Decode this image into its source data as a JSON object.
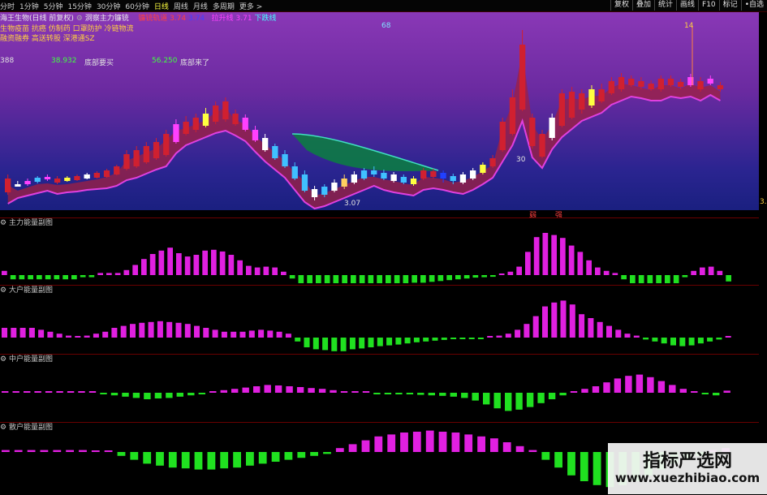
{
  "toolbar": {
    "periods": [
      "分时",
      "1分钟",
      "5分钟",
      "15分钟",
      "30分钟",
      "60分钟",
      "日线",
      "周线",
      "月线",
      "多周期",
      "更多 >"
    ],
    "active_index": 6,
    "right_buttons": [
      "复权",
      "叠加",
      "统计",
      "画线",
      "F10",
      "标记",
      "•自选"
    ]
  },
  "main": {
    "stock_title": "海王生物(日线 前复权)",
    "indicator_name": "洞察主力镰铳",
    "line1_label": "镰铳轨道",
    "line1_value": "3.74",
    "line2_value": "3.74",
    "line3_label": "拉升线",
    "line3_value": "3.71",
    "line4_label": "下跌线",
    "tag_68": "68",
    "tag_14": "14",
    "concept1": "生物疫苗 抗癌 仿制药 口罩防护 冷链物流",
    "concept2": "融资融券 高送转股 深港通SZ",
    "val_388": "388",
    "val_38932": "38.932",
    "bottom_label1": "底部要买",
    "val_56250": "56.250",
    "bottom_label2": "底部来了",
    "label_30": "30",
    "low_price": "3.07",
    "axis_right": "3.0",
    "marker1": "弱",
    "marker2": "强"
  },
  "panels": [
    {
      "name": "主力能量副图"
    },
    {
      "name": "大户能量副图"
    },
    {
      "name": "中户能量副图"
    },
    {
      "name": "散户能量副图"
    }
  ],
  "bars": {
    "main": [
      0.1,
      -0.1,
      -0.1,
      -0.1,
      -0.1,
      -0.1,
      -0.1,
      -0.1,
      -0.1,
      -0.05,
      -0.05,
      0.05,
      0.05,
      0.05,
      0.12,
      0.24,
      0.38,
      0.5,
      0.58,
      0.65,
      0.52,
      0.44,
      0.48,
      0.58,
      0.6,
      0.56,
      0.48,
      0.35,
      0.22,
      0.18,
      0.2,
      0.18,
      0.08,
      -0.08,
      -0.25,
      -0.3,
      -0.32,
      -0.36,
      -0.36,
      -0.34,
      -0.32,
      -0.3,
      -0.28,
      -0.26,
      -0.24,
      -0.22,
      -0.2,
      -0.18,
      -0.18,
      -0.16,
      -0.14,
      -0.12,
      -0.1,
      -0.08,
      -0.06,
      -0.05,
      -0.04,
      0.02,
      0.08,
      0.2,
      0.55,
      0.9,
      1.0,
      0.95,
      0.88,
      0.7,
      0.55,
      0.35,
      0.18,
      0.1,
      0.05,
      -0.1,
      -0.2,
      -0.28,
      -0.35,
      -0.38,
      -0.32,
      -0.22,
      -0.05,
      0.1,
      0.18,
      0.2,
      0.1,
      -0.15
    ],
    "big": [
      0.25,
      0.25,
      0.25,
      0.25,
      0.2,
      0.15,
      0.1,
      0.05,
      0.02,
      0.05,
      0.1,
      0.15,
      0.25,
      0.3,
      0.35,
      0.38,
      0.4,
      0.42,
      0.4,
      0.38,
      0.35,
      0.3,
      0.25,
      0.2,
      0.15,
      0.15,
      0.15,
      0.18,
      0.2,
      0.18,
      0.15,
      0.1,
      -0.1,
      -0.25,
      -0.3,
      -0.32,
      -0.35,
      -0.35,
      -0.3,
      -0.28,
      -0.25,
      -0.22,
      -0.2,
      -0.18,
      -0.15,
      -0.12,
      -0.1,
      -0.08,
      -0.06,
      -0.04,
      -0.03,
      -0.02,
      -0.01,
      0.02,
      0.05,
      0.1,
      0.2,
      0.35,
      0.55,
      0.8,
      0.9,
      0.95,
      0.85,
      0.6,
      0.5,
      0.4,
      0.3,
      0.2,
      0.1,
      0.05,
      -0.05,
      -0.1,
      -0.15,
      -0.2,
      -0.22,
      -0.2,
      -0.15,
      -0.1,
      -0.05,
      0.02
    ],
    "mid": [
      0.05,
      0.05,
      0.05,
      0.05,
      0.05,
      0.05,
      0.05,
      0.05,
      0.05,
      -0.05,
      -0.1,
      -0.15,
      -0.2,
      -0.25,
      -0.22,
      -0.2,
      -0.15,
      -0.1,
      -0.05,
      0.05,
      0.1,
      0.15,
      0.2,
      0.25,
      0.3,
      0.28,
      0.25,
      0.22,
      0.18,
      0.15,
      0.1,
      0.05,
      0.02,
      0.01,
      -0.02,
      -0.03,
      -0.05,
      -0.06,
      -0.08,
      -0.1,
      -0.12,
      -0.15,
      -0.2,
      -0.3,
      -0.45,
      -0.6,
      -0.7,
      -0.65,
      -0.55,
      -0.4,
      -0.25,
      -0.1,
      0.05,
      0.15,
      0.25,
      0.4,
      0.55,
      0.65,
      0.7,
      0.6,
      0.45,
      0.3,
      0.15,
      0.05,
      -0.05,
      -0.1,
      0.08
    ],
    "retail": [
      0.05,
      0.05,
      0.05,
      0.05,
      0.05,
      0.05,
      0.05,
      0.02,
      0.0,
      -0.1,
      -0.2,
      -0.3,
      -0.35,
      -0.4,
      -0.42,
      -0.45,
      -0.45,
      -0.42,
      -0.4,
      -0.35,
      -0.3,
      -0.25,
      -0.2,
      -0.15,
      -0.1,
      -0.05,
      0.1,
      0.2,
      0.3,
      0.4,
      0.45,
      0.5,
      0.52,
      0.55,
      0.52,
      0.5,
      0.45,
      0.4,
      0.35,
      0.25,
      0.15,
      0.05,
      -0.2,
      -0.4,
      -0.6,
      -0.75,
      -0.85,
      -0.9,
      -0.85,
      -0.75,
      -0.6,
      -0.45,
      -0.3,
      -0.2,
      -0.1,
      0.05,
      0.1
    ]
  },
  "colors": {
    "up": "#e020e0",
    "down": "#20e020",
    "panel_border": "#6a0000",
    "upper_band": "#e040e0"
  },
  "watermark": {
    "title": "指标严选网",
    "url": "www.xuezhibiao.com"
  }
}
